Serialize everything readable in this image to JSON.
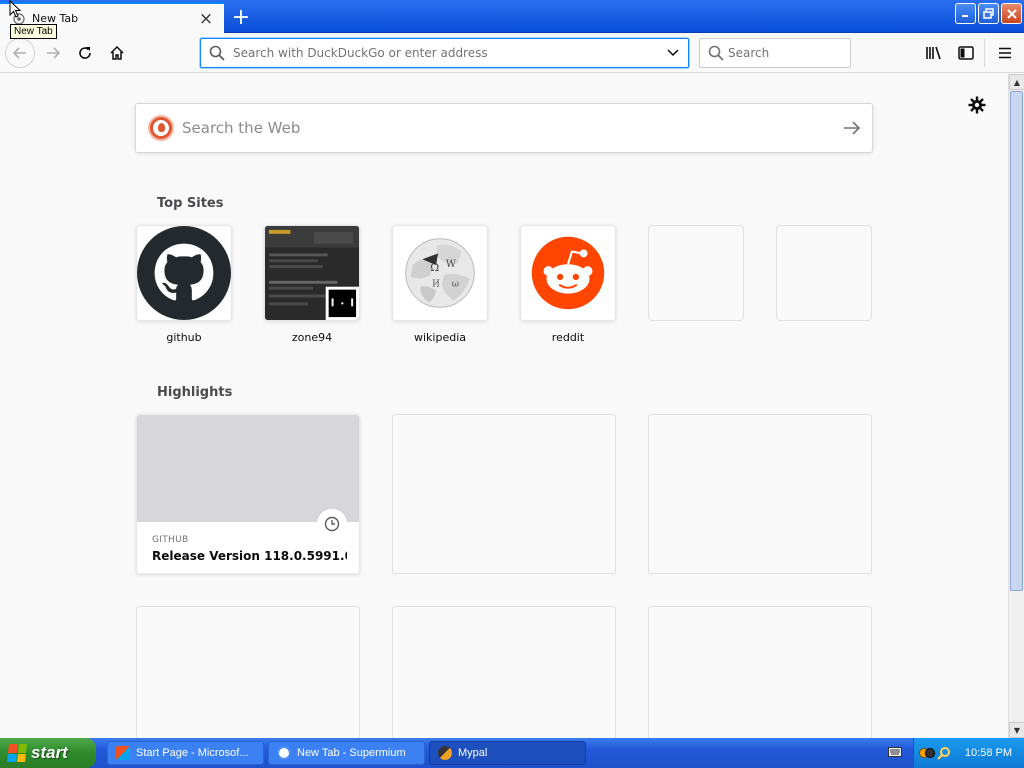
{
  "tab": {
    "title": "New Tab",
    "tooltip": "New Tab"
  },
  "urlbar": {
    "placeholder": "Search with DuckDuckGo or enter address"
  },
  "searchbar": {
    "placeholder": "Search"
  },
  "web_search": {
    "placeholder": "Search the Web"
  },
  "top_sites": {
    "title": "Top Sites",
    "items": [
      {
        "label": "github"
      },
      {
        "label": "zone94"
      },
      {
        "label": "wikipedia"
      },
      {
        "label": "reddit"
      },
      {
        "label": ""
      },
      {
        "label": ""
      }
    ]
  },
  "highlights": {
    "title": "Highlights",
    "cards": [
      {
        "source": "GITHUB",
        "title": "Release Version 118.0.5991.0 · ..."
      }
    ]
  },
  "taskbar": {
    "start_label": "start",
    "tasks": [
      {
        "label": "Start Page - Microsof..."
      },
      {
        "label": "New Tab - Supermium"
      },
      {
        "label": "Mypal"
      }
    ],
    "clock": "10:58 PM"
  },
  "colors": {
    "accent": "#0a84ff",
    "reddit": "#ff4500",
    "duckduckgo": "#de5833",
    "taskbar": "#2258d8",
    "start": "#2f8a2b"
  }
}
